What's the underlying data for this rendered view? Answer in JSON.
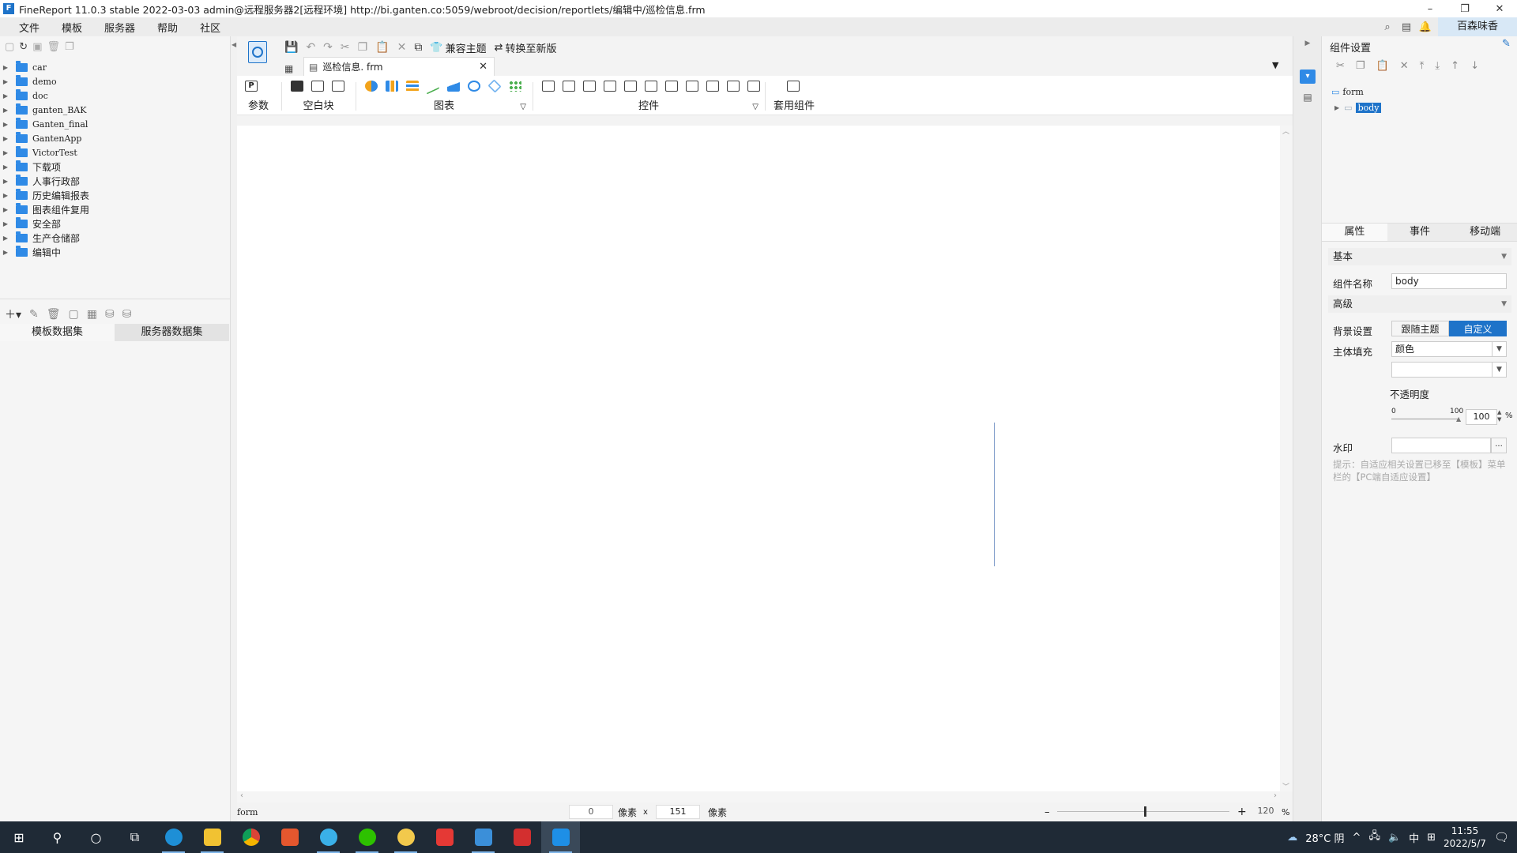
{
  "window": {
    "title": "FineReport 11.0.3 stable 2022-03-03 admin@远程服务器2[远程环境]     http://bi.ganten.co:5059/webroot/decision/reportlets/编辑中/巡检信息.frm",
    "minimize": "–",
    "restore": "❐",
    "close": "✕"
  },
  "menu": {
    "items": [
      "文件",
      "模板",
      "服务器",
      "帮助",
      "社区"
    ],
    "user": "百森味香"
  },
  "tree": {
    "items": [
      {
        "label": "car",
        "mono": true
      },
      {
        "label": "demo",
        "mono": true
      },
      {
        "label": "doc",
        "mono": true
      },
      {
        "label": "ganten_BAK",
        "mono": true
      },
      {
        "label": "Ganten_final",
        "mono": true
      },
      {
        "label": "GantenApp",
        "mono": true
      },
      {
        "label": "VictorTest",
        "mono": true
      },
      {
        "label": "下载项",
        "mono": false
      },
      {
        "label": "人事行政部",
        "mono": false
      },
      {
        "label": "历史编辑报表",
        "mono": false
      },
      {
        "label": "图表组件复用",
        "mono": false
      },
      {
        "label": "安全部",
        "mono": false
      },
      {
        "label": "生产仓储部",
        "mono": false
      },
      {
        "label": "编辑中",
        "mono": false
      }
    ]
  },
  "datasets": {
    "tab_template": "模板数据集",
    "tab_server": "服务器数据集"
  },
  "toolbar": {
    "theme_label": "兼容主题",
    "convert_label": "转换至新版"
  },
  "doc_tab": {
    "name": "巡检信息. frm"
  },
  "widgets": {
    "param_label": "参数",
    "blank_label": "空白块",
    "chart_label": "图表",
    "control_label": "控件",
    "apply_label": "套用组件",
    "param_icon": "P"
  },
  "status": {
    "left": "form",
    "x_value": "0",
    "x_unit": "像素",
    "x_sep": "x",
    "y_value": "151",
    "y_unit": "像素",
    "zoom_minus": "–",
    "zoom_plus": "+",
    "zoom_value": "120",
    "zoom_unit": "%"
  },
  "right": {
    "title": "组件设置",
    "tree": {
      "root": "form",
      "child": "body"
    },
    "tabs": [
      "属性",
      "事件",
      "移动端"
    ],
    "basic_section": "基本",
    "name_label": "组件名称",
    "name_value": "body",
    "advanced_section": "高级",
    "bg_label": "背景设置",
    "bg_follow": "跟随主题",
    "bg_custom": "自定义",
    "fill_label": "主体填充",
    "fill_value": "颜色",
    "opacity_label": "不透明度",
    "opacity_min": "0",
    "opacity_max": "100",
    "opacity_value": "100",
    "opacity_unit": "%",
    "watermark_label": "水印",
    "watermark_btn": "...",
    "hint": "提示：自适应相关设置已移至【模板】菜单栏的【PC端自适应设置】"
  },
  "taskbar": {
    "temperature": "28°C 阴",
    "ime": "中",
    "time": "11:55",
    "date": "2022/5/7"
  },
  "colors": {
    "accent": "#1e73c9",
    "folder": "#2f8ae6",
    "taskbar": "#1f2a36"
  }
}
